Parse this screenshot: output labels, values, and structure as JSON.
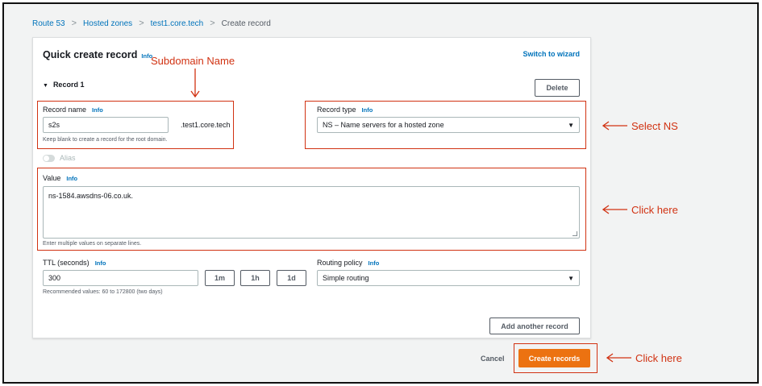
{
  "breadcrumb": {
    "items": [
      "Route 53",
      "Hosted zones",
      "test1.core.tech",
      "Create record"
    ],
    "separator": ">"
  },
  "panel": {
    "title": "Quick create record",
    "info": "Info",
    "switch_wizard": "Switch to wizard"
  },
  "record": {
    "header": "Record 1",
    "delete_label": "Delete",
    "name": {
      "label": "Record name",
      "info": "Info",
      "value": "s2s",
      "suffix": ".test1.core.tech",
      "hint": "Keep blank to create a record for the root domain."
    },
    "type": {
      "label": "Record type",
      "info": "Info",
      "selected": "NS – Name servers for a hosted zone"
    },
    "alias_label": "Alias",
    "value": {
      "label": "Value",
      "info": "Info",
      "text": "ns-1584.awsdns-06.co.uk.",
      "hint": "Enter multiple values on separate lines."
    },
    "ttl": {
      "label": "TTL (seconds)",
      "info": "Info",
      "value": "300",
      "btn_1m": "1m",
      "btn_1h": "1h",
      "btn_1d": "1d",
      "hint": "Recommended values: 60 to 172800 (two days)"
    },
    "routing": {
      "label": "Routing policy",
      "info": "Info",
      "selected": "Simple routing"
    }
  },
  "add_another_label": "Add another record",
  "footer": {
    "cancel_label": "Cancel",
    "create_label": "Create records"
  },
  "annotations": {
    "subdomain": "Subdomain Name",
    "select_ns": "Select NS",
    "click_value": "Click here",
    "click_create": "Click here"
  },
  "colors": {
    "accent": "#ec7211",
    "link": "#0073bb",
    "annotation": "#d13212"
  }
}
